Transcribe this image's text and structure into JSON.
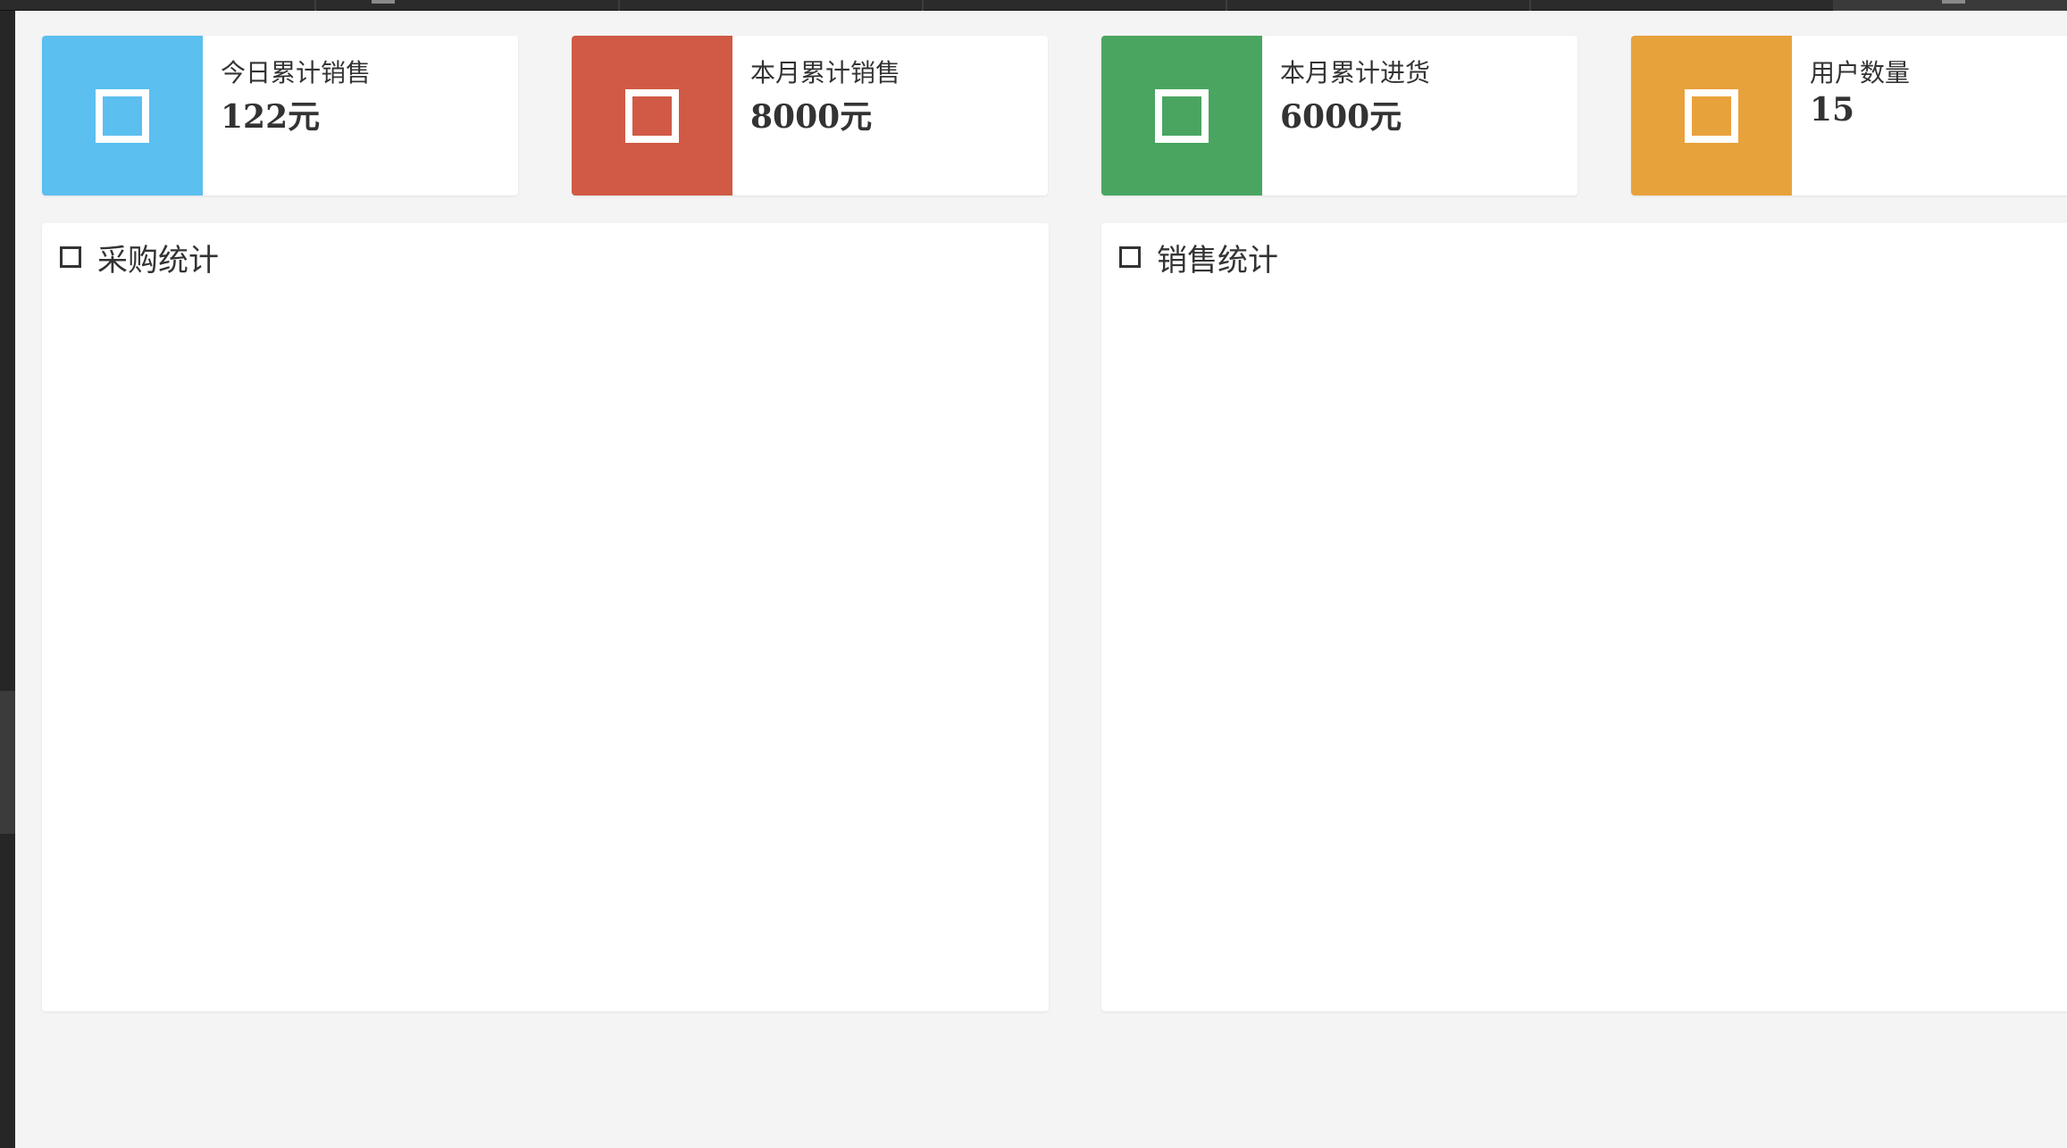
{
  "stats": [
    {
      "label": "今日累计销售",
      "value": "122元",
      "color": "#5bbfef",
      "icon": "square-icon"
    },
    {
      "label": "本月累计销售",
      "value": "8000元",
      "color": "#d05a45",
      "icon": "square-icon"
    },
    {
      "label": "本月累计进货",
      "value": "6000元",
      "color": "#4aa561",
      "icon": "square-icon"
    },
    {
      "label": "用户数量",
      "value": "15",
      "color": "#e8a23c",
      "icon": "square-icon"
    }
  ],
  "panels": [
    {
      "title": "采购统计",
      "icon": "square-icon"
    },
    {
      "title": "销售统计",
      "icon": "square-icon"
    }
  ]
}
